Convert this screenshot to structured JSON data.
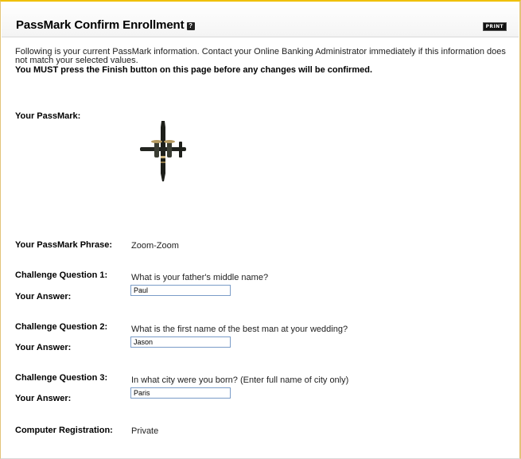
{
  "header": {
    "title": "PassMark Confirm Enrollment",
    "help_icon_text": "?",
    "print_label": "PRINT"
  },
  "intro": {
    "text": "Following is your current PassMark information. Contact your Online Banking Administrator immediately if this information does not match your selected values.",
    "warning": "You MUST press the Finish button on this page before any changes will be confirmed."
  },
  "passmark": {
    "label": "Your PassMark:",
    "image": "airplane-image"
  },
  "phrase": {
    "label": "Your PassMark Phrase:",
    "value": "Zoom-Zoom"
  },
  "questions": [
    {
      "label": "Challenge Question 1:",
      "question": "What is your father's middle name?",
      "answer_label": "Your Answer:",
      "answer": "Paul"
    },
    {
      "label": "Challenge Question 2:",
      "question": "What is the first name of the best man at your wedding?",
      "answer_label": "Your Answer:",
      "answer": "Jason"
    },
    {
      "label": "Challenge Question 3:",
      "question": "In what city were you born? (Enter full name of city only)",
      "answer_label": "Your Answer:",
      "answer": "Paris"
    }
  ],
  "registration": {
    "label": "Computer Registration:",
    "value": "Private"
  },
  "colors": {
    "accent_border": "#f0c000",
    "input_border": "#7a9cc8"
  }
}
